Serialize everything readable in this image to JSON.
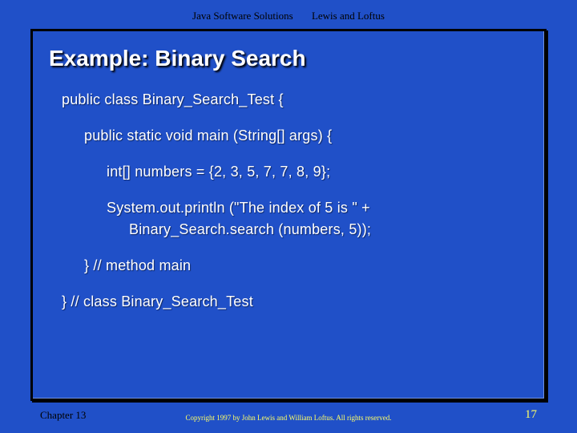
{
  "header": {
    "book": "Java Software Solutions",
    "authors": "Lewis and Loftus"
  },
  "title": "Example: Binary Search",
  "code": {
    "line1": "public class Binary_Search_Test {",
    "line2": "public static void main (String[] args) {",
    "line3": "int[] numbers = {2, 3, 5, 7, 7, 8, 9};",
    "line4a": "System.out.println (\"The index of 5 is \" +",
    "line4b": "Binary_Search.search (numbers, 5));",
    "line5": "}  // method main",
    "line6": "}  // class Binary_Search_Test"
  },
  "footer": {
    "chapter": "Chapter 13",
    "copyright": "Copyright 1997 by John Lewis and William Loftus.  All rights reserved.",
    "page": "17"
  }
}
